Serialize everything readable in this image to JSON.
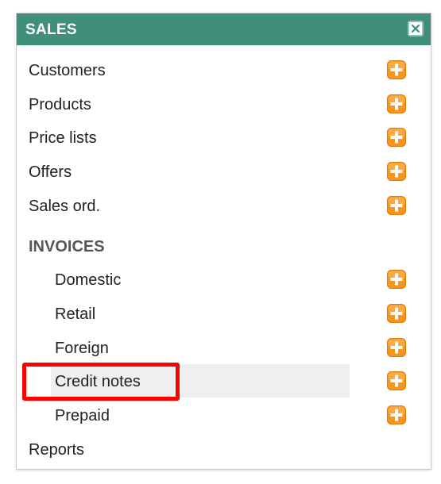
{
  "panel": {
    "title": "SALES",
    "close_icon": "close-icon",
    "header_color": "#3f8f7b"
  },
  "menu": {
    "top_items": [
      {
        "label": "Customers",
        "icon": "add-icon"
      },
      {
        "label": "Products",
        "icon": "add-icon"
      },
      {
        "label": "Price lists",
        "icon": "add-icon"
      },
      {
        "label": "Offers",
        "icon": "add-icon"
      },
      {
        "label": "Sales ord.",
        "icon": "add-icon"
      }
    ],
    "section_heading": "INVOICES",
    "invoice_items": [
      {
        "label": "Domestic",
        "icon": "add-icon"
      },
      {
        "label": "Retail",
        "icon": "add-icon"
      },
      {
        "label": "Foreign",
        "icon": "add-icon"
      },
      {
        "label": "Credit notes",
        "icon": "add-icon",
        "highlighted": true
      },
      {
        "label": "Prepaid",
        "icon": "add-icon"
      }
    ],
    "footer_item": {
      "label": "Reports"
    }
  },
  "colors": {
    "accent": "#3f8f7b",
    "add_icon_fill": "#f7941d",
    "highlight_border": "#ff0000",
    "hover_background": "#efefef"
  }
}
